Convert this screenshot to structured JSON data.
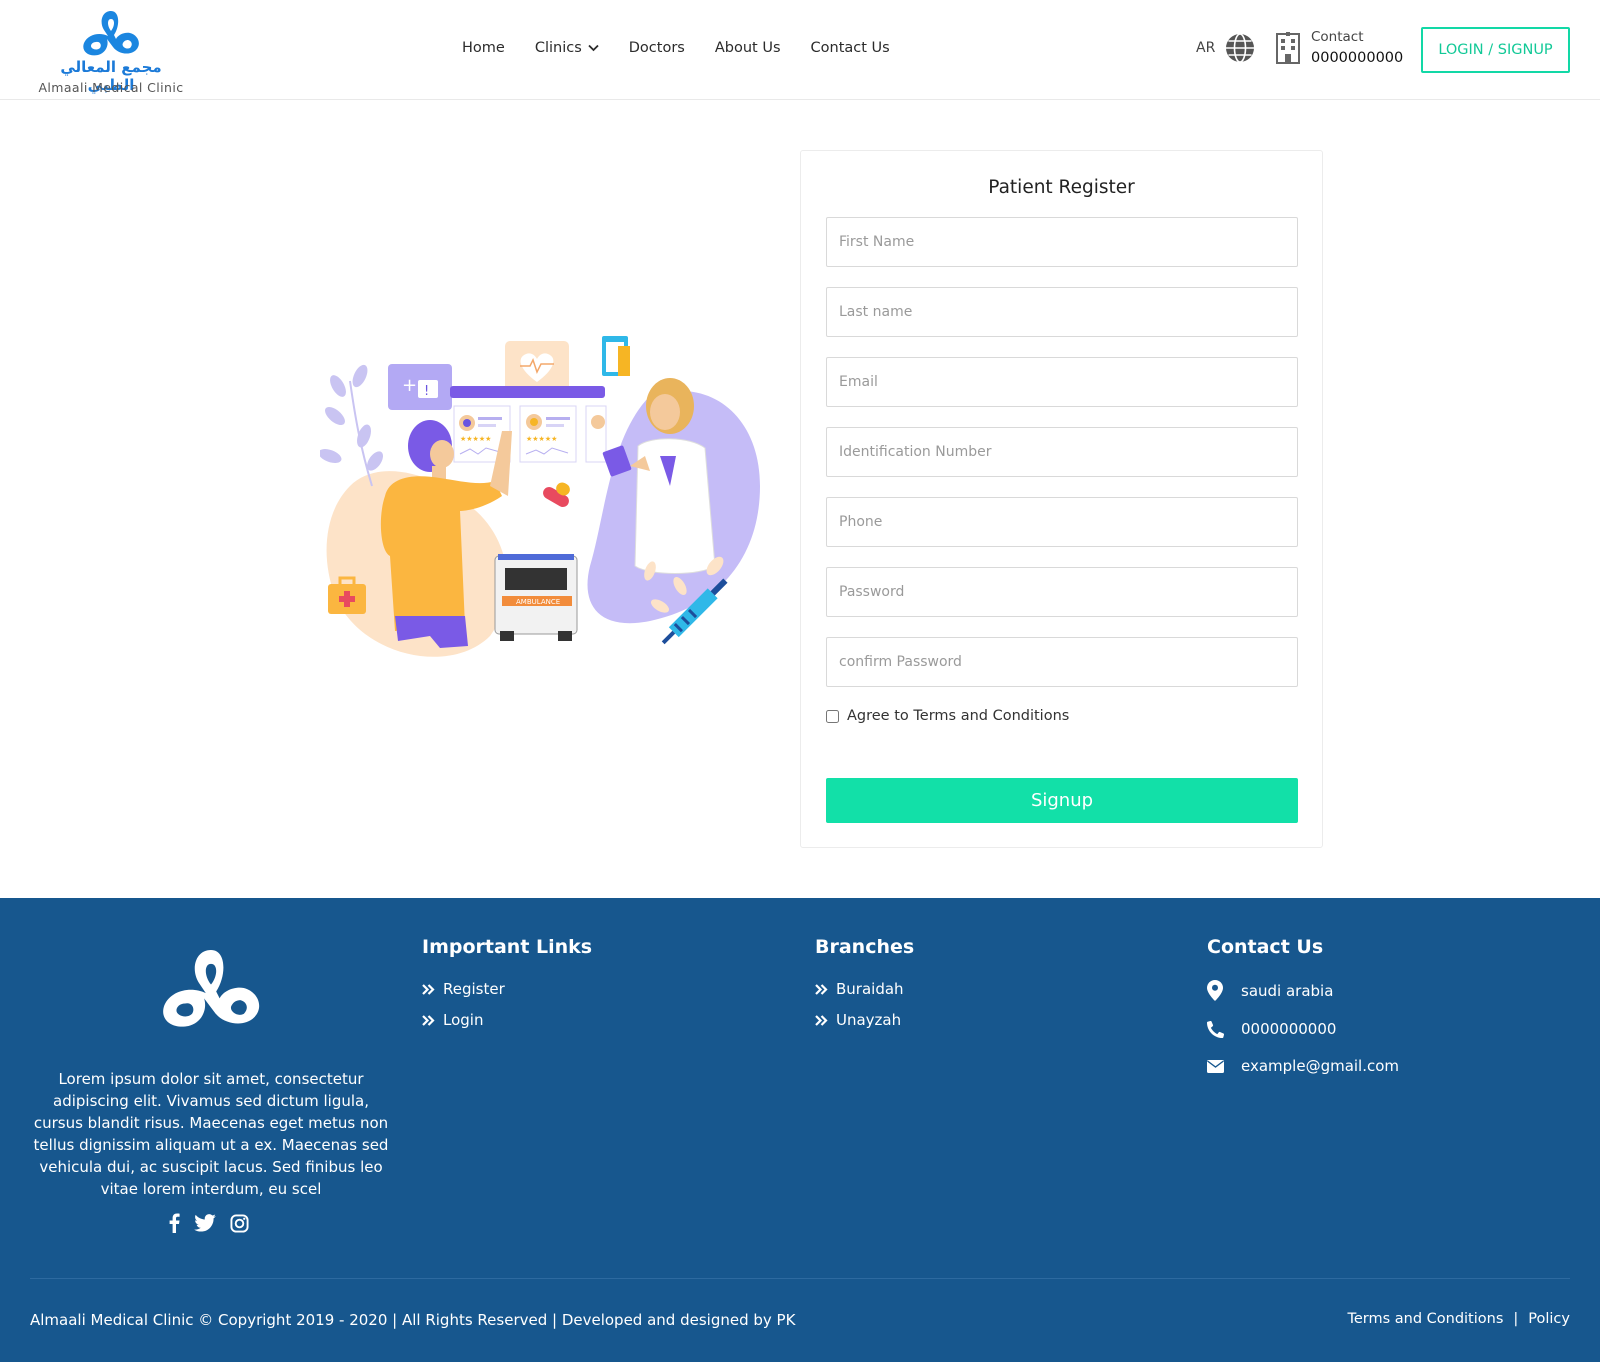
{
  "brand": {
    "arabic_name": "مجمع المعالي الطبي",
    "english_name": "Almaali Medical Clinic",
    "accent_color": "#12d8a6",
    "footer_color": "#17578e"
  },
  "nav": {
    "items": [
      "Home",
      "Clinics",
      "Doctors",
      "About Us",
      "Contact Us"
    ],
    "clinics_dropdown_icon": "chevron-down-icon"
  },
  "header": {
    "lang": "AR",
    "contact_label": "Contact",
    "contact_phone": "0000000000",
    "login_label": "LOGIN / SIGNUP"
  },
  "form": {
    "title": "Patient Register",
    "placeholders": {
      "first_name": "First Name",
      "last_name": "Last name",
      "email": "Email",
      "id_number": "Identification Number",
      "phone": "Phone",
      "password": "Password",
      "confirm_password": "confirm Password"
    },
    "agree_label": "Agree to Terms and Conditions",
    "signup_label": "Signup"
  },
  "footer": {
    "about": "Lorem ipsum dolor sit amet, consectetur adipiscing elit. Vivamus sed dictum ligula, cursus blandit risus. Maecenas eget metus non tellus dignissim aliquam ut a ex. Maecenas sed vehicula dui, ac suscipit lacus. Sed finibus leo vitae lorem interdum, eu scel",
    "links_heading": "Important Links",
    "links": [
      "Register",
      "Login"
    ],
    "branches_heading": "Branches",
    "branches": [
      "Buraidah",
      "Unayzah"
    ],
    "contact_heading": "Contact Us",
    "address": "saudi arabia",
    "phone": "0000000000",
    "email": "example@gmail.com",
    "copyright": "Almaali Medical Clinic © Copyright 2019 - 2020 | All Rights Reserved | Developed and designed by PK",
    "terms": "Terms and Conditions",
    "separator": "|",
    "policy": "Policy"
  }
}
